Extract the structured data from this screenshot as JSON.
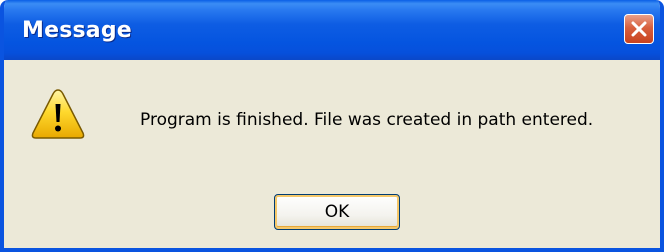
{
  "window": {
    "title": "Message",
    "close_icon": "close-icon"
  },
  "dialog": {
    "icon": "warning-icon",
    "message": "Program is finished. File was created in path entered.",
    "ok_label": "OK"
  },
  "colors": {
    "titlebar_blue": "#0555e0",
    "dialog_bg": "#ece9d8",
    "close_red": "#d8603e"
  }
}
